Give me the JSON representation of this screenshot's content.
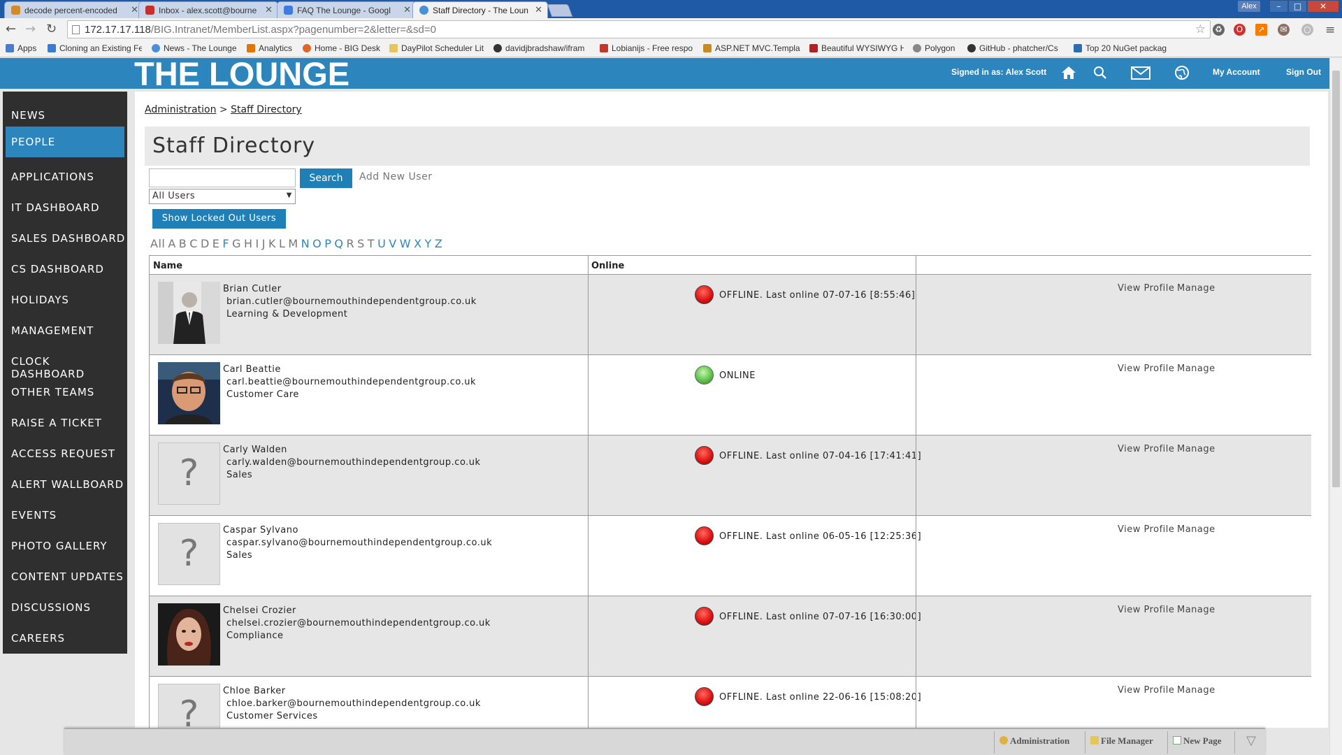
{
  "browser": {
    "tabs": [
      {
        "title": "decode percent-encoded",
        "color": "#d18b2f"
      },
      {
        "title": "Inbox - alex.scott@bourne",
        "color": "#c4302b"
      },
      {
        "title": "FAQ The Lounge - Googl",
        "color": "#3d7be0"
      },
      {
        "title": "Staff Directory - The Loun",
        "color": "#4a90d9"
      }
    ],
    "user_badge": "Alex",
    "window_buttons": {
      "minimize": "–",
      "maximize": "□",
      "close": "✕"
    },
    "url_host": "172.17.17.118",
    "url_path": "/BIG.Intranet/MemberList.aspx?pagenumber=2&letter=&sd=0",
    "bookmarks": [
      {
        "label": "Apps",
        "color": "#4a7bd0"
      },
      {
        "label": "Cloning an Existing Fe",
        "color": "#3b7bd4"
      },
      {
        "label": "News - The Lounge",
        "color": "#4a90d9"
      },
      {
        "label": "Analytics",
        "color": "#e37400"
      },
      {
        "label": "Home - BIG Desk",
        "color": "#e0662a"
      },
      {
        "label": "DayPilot Scheduler Lit",
        "color": "#e6c65a"
      },
      {
        "label": "davidjbradshaw/ifram",
        "color": "#333333"
      },
      {
        "label": "Lobianijs - Free respo",
        "color": "#c0392b"
      },
      {
        "label": "ASP.NET MVC.Templa",
        "color": "#c98a1e"
      },
      {
        "label": "Beautiful WYSIWYG H",
        "color": "#b22222"
      },
      {
        "label": "Polygon",
        "color": "#888888"
      },
      {
        "label": "GitHub - phatcher/Cs",
        "color": "#333333"
      },
      {
        "label": "Top 20 NuGet packag",
        "color": "#2a6db5"
      }
    ]
  },
  "header": {
    "logo": "THE LOUNGE",
    "signed_in": "Signed in as: Alex Scott",
    "my_account": "My Account",
    "sign_out": "Sign Out"
  },
  "sidebar": {
    "items": [
      {
        "label": "NEWS",
        "active": false
      },
      {
        "label": "PEOPLE",
        "active": true
      },
      {
        "label": "APPLICATIONS",
        "active": false
      },
      {
        "label": "IT DASHBOARD",
        "active": false
      },
      {
        "label": "SALES DASHBOARD",
        "active": false
      },
      {
        "label": "CS DASHBOARD",
        "active": false
      },
      {
        "label": "HOLIDAYS",
        "active": false
      },
      {
        "label": "MANAGEMENT",
        "active": false
      },
      {
        "label": "CLOCK DASHBOARD",
        "active": false
      },
      {
        "label": "OTHER TEAMS",
        "active": false
      },
      {
        "label": "RAISE A TICKET",
        "active": false
      },
      {
        "label": "ACCESS REQUEST",
        "active": false
      },
      {
        "label": "ALERT WALLBOARD",
        "active": false
      },
      {
        "label": "EVENTS",
        "active": false
      },
      {
        "label": "PHOTO GALLERY",
        "active": false
      },
      {
        "label": "CONTENT UPDATES",
        "active": false
      },
      {
        "label": "DISCUSSIONS",
        "active": false
      },
      {
        "label": "CAREERS",
        "active": false
      }
    ]
  },
  "breadcrumb": {
    "parent": "Administration",
    "separator": ">",
    "current": "Staff Directory"
  },
  "page": {
    "title": "Staff Directory",
    "search_value": "",
    "search_label": "Search",
    "add_user_label": "Add New User",
    "filter_selected": "All Users",
    "locked_label": "Show Locked Out Users",
    "letters": [
      {
        "l": "All",
        "on": false
      },
      {
        "l": "A",
        "on": false
      },
      {
        "l": "B",
        "on": false
      },
      {
        "l": "C",
        "on": false
      },
      {
        "l": "D",
        "on": false
      },
      {
        "l": "E",
        "on": false
      },
      {
        "l": "F",
        "on": true
      },
      {
        "l": "G",
        "on": false
      },
      {
        "l": "H",
        "on": false
      },
      {
        "l": "I",
        "on": false
      },
      {
        "l": "J",
        "on": false
      },
      {
        "l": "K",
        "on": false
      },
      {
        "l": "L",
        "on": false
      },
      {
        "l": "M",
        "on": false
      },
      {
        "l": "N",
        "on": true
      },
      {
        "l": "O",
        "on": true
      },
      {
        "l": "P",
        "on": true
      },
      {
        "l": "Q",
        "on": true
      },
      {
        "l": "R",
        "on": false
      },
      {
        "l": "S",
        "on": false
      },
      {
        "l": "T",
        "on": false
      },
      {
        "l": "U",
        "on": true
      },
      {
        "l": "V",
        "on": true
      },
      {
        "l": "W",
        "on": true
      },
      {
        "l": "X",
        "on": true
      },
      {
        "l": "Y",
        "on": true
      },
      {
        "l": "Z",
        "on": true
      }
    ]
  },
  "table": {
    "headers": [
      "Name",
      "Online",
      ""
    ],
    "view_label": "View Profile",
    "manage_label": "Manage",
    "rows": [
      {
        "name": "Brian Cutler",
        "email": "brian.cutler@bournemouthindependentgroup.co.uk",
        "dept": "Learning & Development",
        "status": "offline",
        "status_text": "OFFLINE. Last online 07-07-16 [8:55:46]",
        "photo": "man-suit"
      },
      {
        "name": "Carl Beattie",
        "email": "carl.beattie@bournemouthindependentgroup.co.uk",
        "dept": "Customer Care",
        "status": "online",
        "status_text": "ONLINE",
        "photo": "man-glasses"
      },
      {
        "name": "Carly Walden",
        "email": "carly.walden@bournemouthindependentgroup.co.uk",
        "dept": "Sales",
        "status": "offline",
        "status_text": "OFFLINE. Last online 07-04-16 [17:41:41]",
        "photo": "none"
      },
      {
        "name": "Caspar Sylvano",
        "email": "caspar.sylvano@bournemouthindependentgroup.co.uk",
        "dept": "Sales",
        "status": "offline",
        "status_text": "OFFLINE. Last online 06-05-16 [12:25:36]",
        "photo": "none"
      },
      {
        "name": "Chelsei Crozier",
        "email": "chelsei.crozier@bournemouthindependentgroup.co.uk",
        "dept": "Compliance",
        "status": "offline",
        "status_text": "OFFLINE. Last online 07-07-16 [16:30:00]",
        "photo": "woman"
      },
      {
        "name": "Chloe Barker",
        "email": "chloe.barker@bournemouthindependentgroup.co.uk",
        "dept": "Customer Services",
        "status": "offline",
        "status_text": "OFFLINE. Last online 22-06-16 [15:08:20]",
        "photo": "none"
      }
    ]
  },
  "adminbar": {
    "administration": "Administration",
    "file_manager": "File Manager",
    "new_page": "New Page"
  },
  "colors": {
    "brand": "#2c86bd",
    "sidebar": "#2f2f2f",
    "button": "#1f7fb7",
    "offline": "#e11414",
    "online": "#5fc34a"
  }
}
